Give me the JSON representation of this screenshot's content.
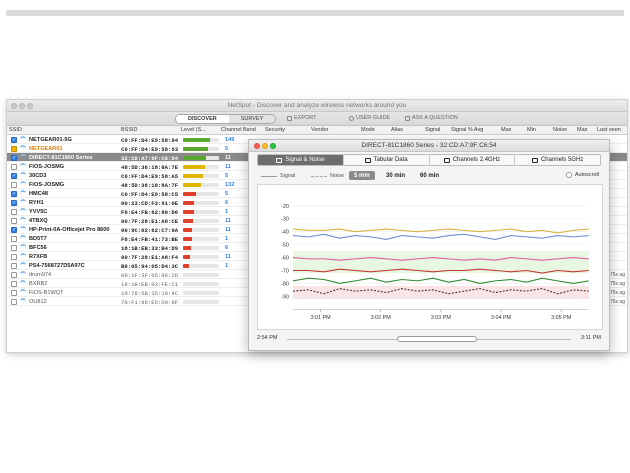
{
  "app": {
    "title": "NetSpot - Discover and analyze wireless networks around you"
  },
  "toolbar": {
    "discover_label": "DISCOVER",
    "survey_label": "SURVEY",
    "export_label": "EXPORT",
    "guide_label": "USER GUIDE",
    "ask_label": "ASK A QUESTION"
  },
  "columns": [
    "SSID",
    "BSSID",
    "Level (S...",
    "Channel",
    "Band",
    "Security",
    "Vendor",
    "Mode",
    "Alias",
    "Signal",
    "Signal % Avg",
    "Max",
    "Min",
    "Noise",
    "Max",
    "Last seen"
  ],
  "networks": [
    {
      "ssid": "NETGEAR01-5G",
      "bssid": "C0:FF:D4:E9:58:94",
      "level": 0.75,
      "level_color": "#5aa832",
      "channel": "149",
      "check": "checked",
      "style": "",
      "last": ""
    },
    {
      "ssid": "NETGEAR01",
      "bssid": "C0:FF:D4:E9:58:93",
      "level": 0.7,
      "level_color": "#5aa832",
      "channel": "5",
      "check": "bullet",
      "style": "orange",
      "last": ""
    },
    {
      "ssid": "DIRECT-81C1860 Series",
      "bssid": "32:CD:A7:9F:C6:54",
      "level": 0.65,
      "level_color": "#5aa832",
      "channel": "11",
      "check": "checked",
      "style": "",
      "last": "",
      "selected": true
    },
    {
      "ssid": "FiOS-JOSMG",
      "bssid": "48:5D:36:18:8A:7E",
      "level": 0.6,
      "level_color": "#e0b400",
      "channel": "11",
      "check": "",
      "style": "",
      "last": ""
    },
    {
      "ssid": "30CD3",
      "bssid": "C0:FF:D4:E9:58:A5",
      "level": 0.55,
      "level_color": "#e0b400",
      "channel": "5",
      "check": "checked",
      "style": "",
      "last": ""
    },
    {
      "ssid": "FiOS-JOSMG",
      "bssid": "48:5D:36:18:8A:7F",
      "level": 0.5,
      "level_color": "#e0b400",
      "channel": "132",
      "check": "",
      "style": "",
      "last": ""
    },
    {
      "ssid": "HMC48",
      "bssid": "C0:FF:D4:E9:58:C5",
      "level": 0.35,
      "level_color": "#e0402a",
      "channel": "5",
      "check": "checked",
      "style": "",
      "last": ""
    },
    {
      "ssid": "RYH1",
      "bssid": "00:23:CD:F3:91:0E",
      "level": 0.3,
      "level_color": "#e0402a",
      "channel": "6",
      "check": "checked",
      "style": "",
      "last": ""
    },
    {
      "ssid": "YVV5C",
      "bssid": "F8:E4:FB:62:80:D6",
      "level": 0.3,
      "level_color": "#e0402a",
      "channel": "1",
      "check": "",
      "style": "",
      "last": ""
    },
    {
      "ssid": "4TBXQ",
      "bssid": "00:7F:28:E1:A8:CE",
      "level": 0.28,
      "level_color": "#e0402a",
      "channel": "11",
      "check": "",
      "style": "",
      "last": ""
    },
    {
      "ssid": "HP-Print-0A-Officejet Pro 8600",
      "bssid": "00:9C:02:62:C7:0A",
      "level": 0.26,
      "level_color": "#e0402a",
      "channel": "11",
      "check": "checked",
      "style": "",
      "last": ""
    },
    {
      "ssid": "BD5T7",
      "bssid": "F8:E4:FB:41:73:BE",
      "level": 0.24,
      "level_color": "#e0402a",
      "channel": "1",
      "check": "",
      "style": "",
      "last": ""
    },
    {
      "ssid": "BFC56",
      "bssid": "18:1B:EB:33:B4:D9",
      "level": 0.22,
      "level_color": "#e0402a",
      "channel": "6",
      "check": "",
      "style": "",
      "last": ""
    },
    {
      "ssid": "R7XFB",
      "bssid": "00:7F:28:E1:A8:F4",
      "level": 0.2,
      "level_color": "#e0402a",
      "channel": "11",
      "check": "",
      "style": "",
      "last": ""
    },
    {
      "ssid": "PS4-7568727D5A97C",
      "bssid": "B0:05:94:05:D4:3C",
      "level": 0.18,
      "level_color": "#e0402a",
      "channel": "1",
      "check": "",
      "style": "",
      "last": ""
    },
    {
      "ssid": "drum974",
      "bssid": "00:1F:3F:05:86:2D",
      "level": 0.0,
      "level_color": "#cccccc",
      "channel": "",
      "check": "",
      "style": "gray",
      "last": "75s ag",
      "dim": true
    },
    {
      "ssid": "BXRB2",
      "bssid": "18:1B:EB:03:FE:C1",
      "level": 0.0,
      "level_color": "#cccccc",
      "channel": "",
      "check": "",
      "style": "gray",
      "last": "75s ag",
      "dim": true
    },
    {
      "ssid": "FiOS-B1WQT",
      "bssid": "10:78:5B:35:18:4C",
      "level": 0.0,
      "level_color": "#cccccc",
      "channel": "",
      "check": "",
      "style": "gray",
      "last": "75s ag",
      "dim": true
    },
    {
      "ssid": "OU812",
      "bssid": "70:F1:96:E5:D0:6F",
      "level": 0.0,
      "level_color": "#cccccc",
      "channel": "",
      "check": "",
      "style": "gray",
      "last": "75s ag",
      "dim": true
    }
  ],
  "detail": {
    "title": "DIRECT-81C1860 Series - 32:CD:A7:9F:C6:54",
    "tabs": [
      "Signal & Noise",
      "Tabular Data",
      "Channels 2.4GHz",
      "Channels 5GHz"
    ],
    "legend_signal": "Signal",
    "legend_noise": "Noise",
    "ranges": [
      "5 min",
      "30 min",
      "60 min"
    ],
    "autoscroll": "Autoscroll",
    "scroll_start": "2:54 PM",
    "scroll_end": "3:11 PM"
  },
  "chart_data": {
    "type": "line",
    "ylim": [
      -100,
      -10
    ],
    "yticks": [
      "-20",
      "-30",
      "-40",
      "-50",
      "-60",
      "-70",
      "-80",
      "-90"
    ],
    "xticks": [
      "3:01 PM",
      "3:02 PM",
      "3:03 PM",
      "3:04 PM",
      "3:05 PM"
    ],
    "series": [
      {
        "color": "#d9b23a",
        "values": [
          -38,
          -39,
          -39,
          -38,
          -40,
          -39,
          -38,
          -39,
          -40,
          -39,
          -38,
          -39,
          -40,
          -39,
          -38,
          -40,
          -39,
          -41,
          -39,
          -38
        ]
      },
      {
        "color": "#6f8fd1",
        "values": [
          -43,
          -44,
          -42,
          -45,
          -43,
          -44,
          -46,
          -43,
          -44,
          -45,
          -43,
          -42,
          -44,
          -46,
          -43,
          -44,
          -45,
          -43,
          -44,
          -43
        ]
      },
      {
        "color": "#e05c9a",
        "values": [
          -60,
          -61,
          -61,
          -62,
          -61,
          -60,
          -61,
          -62,
          -61,
          -60,
          -61,
          -62,
          -61,
          -62,
          -60,
          -61,
          -62,
          -61,
          -60,
          -61
        ]
      },
      {
        "color": "#c0392b",
        "values": [
          -70,
          -70,
          -71,
          -69,
          -70,
          -71,
          -70,
          -69,
          -70,
          -71,
          -70,
          -70,
          -69,
          -70,
          -71,
          -70,
          -72,
          -70,
          -71,
          -70
        ]
      },
      {
        "color": "#2e8b2e",
        "values": [
          -78,
          -76,
          -77,
          -80,
          -78,
          -76,
          -79,
          -77,
          -78,
          -76,
          -79,
          -77,
          -80,
          -78,
          -77,
          -79,
          -76,
          -78,
          -80,
          -78
        ]
      },
      {
        "color": "#3a3a3a",
        "dashed": true,
        "values": [
          -86,
          -85,
          -88,
          -84,
          -86,
          -85,
          -87,
          -84,
          -86,
          -85,
          -88,
          -86,
          -84,
          -87,
          -85,
          -86,
          -84,
          -88,
          -85,
          -86
        ]
      }
    ]
  }
}
